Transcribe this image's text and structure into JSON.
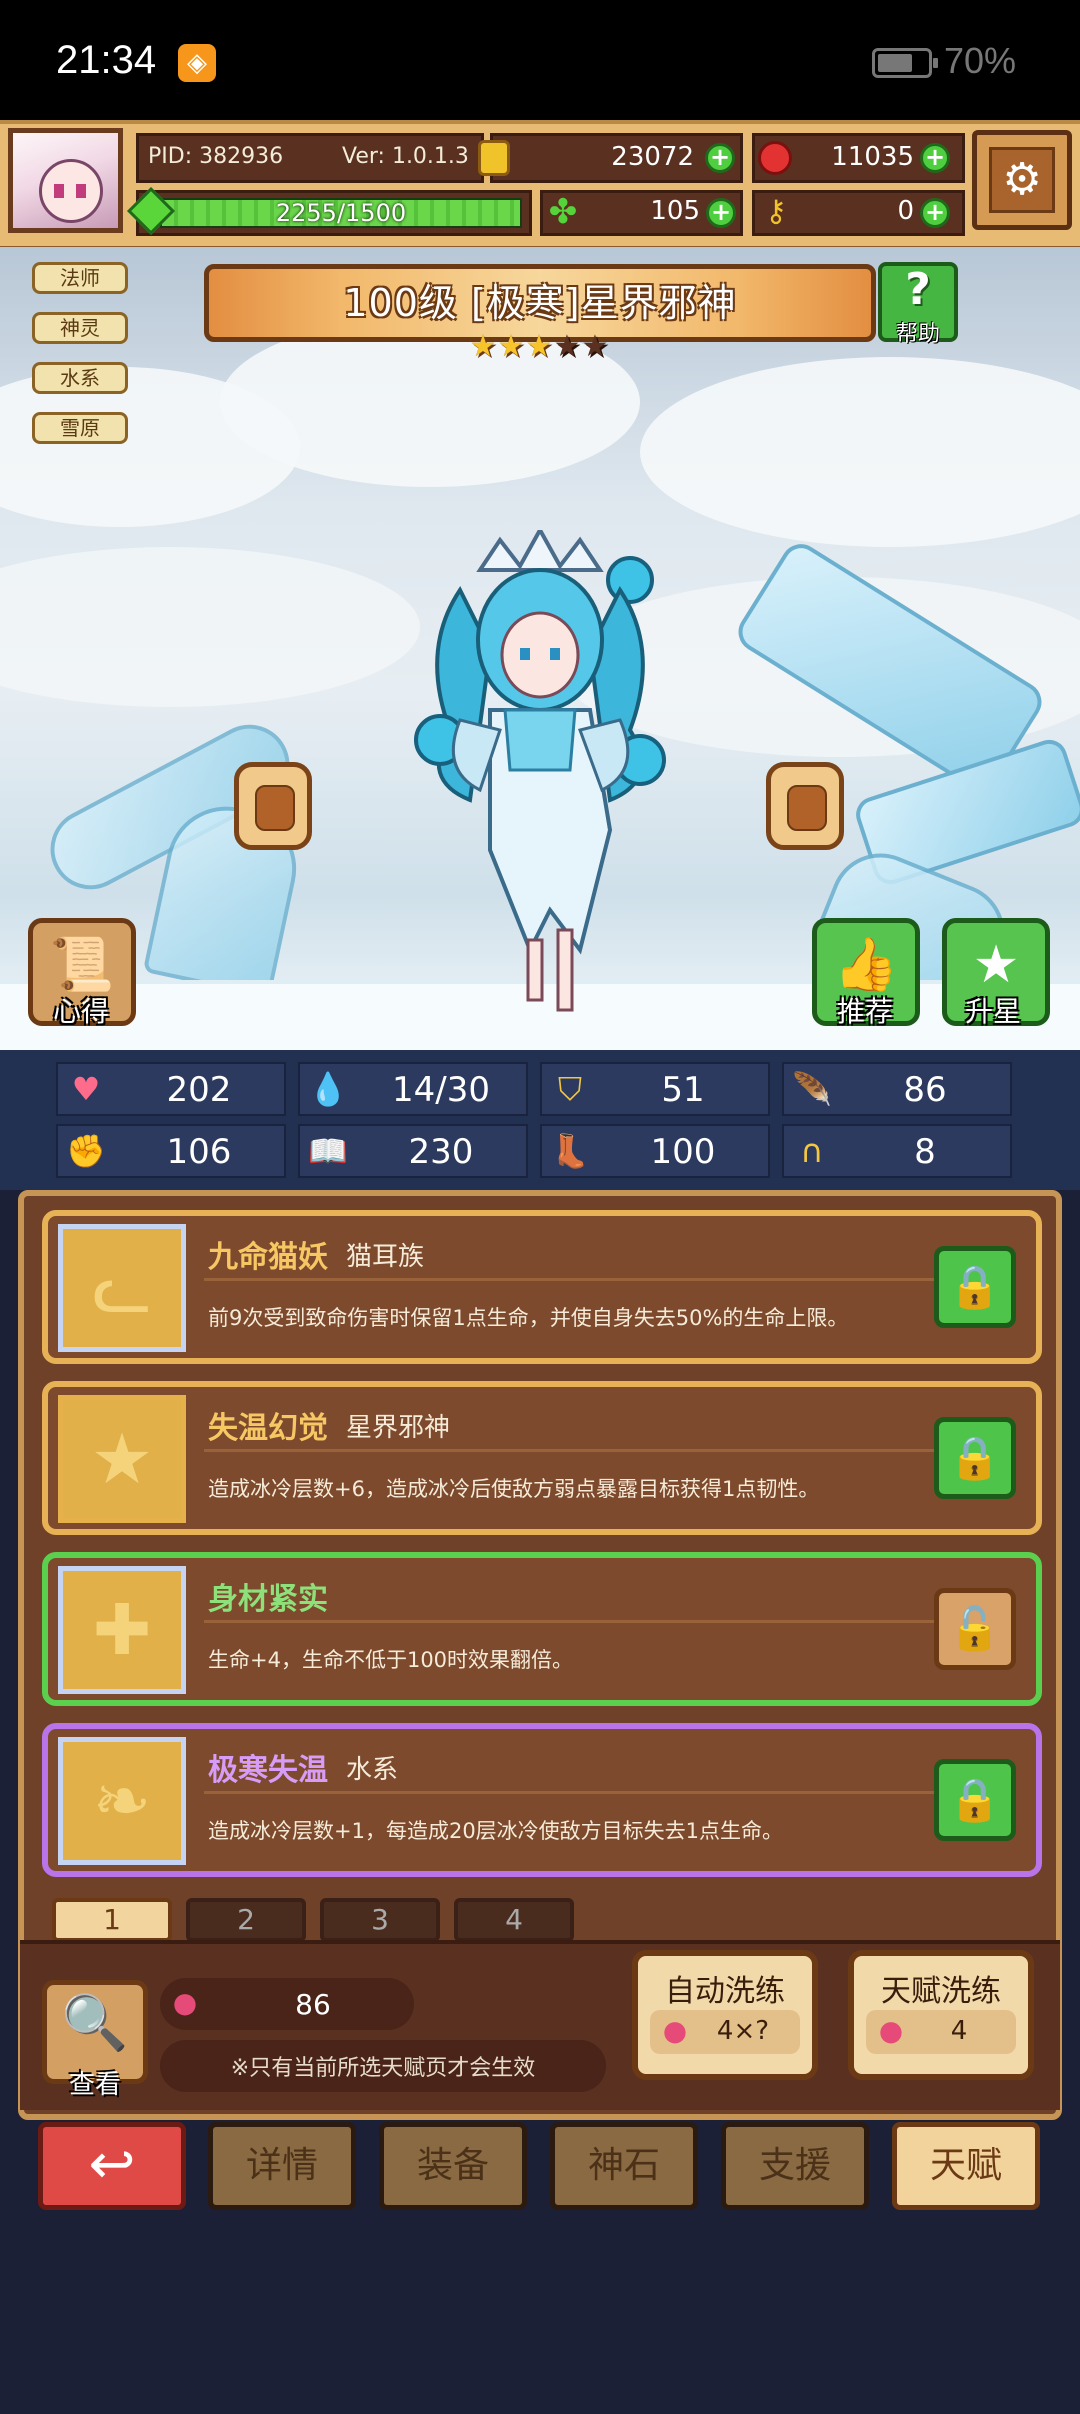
{
  "status_bar": {
    "time": "21:34",
    "battery_percent": "70%",
    "battery_level": 0.7
  },
  "header": {
    "pid": "PID: 382936",
    "version": "Ver: 1.0.1.3",
    "gold": "23072",
    "gems": "11035",
    "exp": "2255/1500",
    "clover": "105",
    "keys": "0"
  },
  "tags": [
    "法师",
    "神灵",
    "水系",
    "雪原"
  ],
  "hero": {
    "title": "100级 [极寒]星界邪神",
    "stars_filled": 3,
    "stars_total": 5,
    "help_label": "帮助"
  },
  "scene_buttons": {
    "xinde": "心得",
    "recommend": "推荐",
    "star_up": "升星"
  },
  "stats": [
    {
      "icon": "heart-icon",
      "value": "202"
    },
    {
      "icon": "water-drop-icon",
      "value": "14/30"
    },
    {
      "icon": "shield-icon",
      "value": "51"
    },
    {
      "icon": "wing-icon",
      "value": "86"
    },
    {
      "icon": "fist-icon",
      "value": "106"
    },
    {
      "icon": "book-icon",
      "value": "230"
    },
    {
      "icon": "boot-icon",
      "value": "100"
    },
    {
      "icon": "horseshoe-icon",
      "value": "8"
    }
  ],
  "talents": [
    {
      "name": "九命猫妖",
      "sub": "猫耳族",
      "desc": "前9次受到致命伤害时保留1点生命，并使自身失去50%的生命上限。",
      "style": "gold",
      "locked": true,
      "icon": "cat-icon"
    },
    {
      "name": "失温幻觉",
      "sub": "星界邪神",
      "desc": "造成冰冷层数+6，造成冰冷后使敌方弱点暴露目标获得1点韧性。",
      "style": "gold",
      "locked": true,
      "icon": "star-icon"
    },
    {
      "name": "身材紧实",
      "sub": "",
      "desc": "生命+4，生命不低于100时效果翻倍。",
      "style": "green",
      "locked": false,
      "icon": "cross-icon"
    },
    {
      "name": "极寒失温",
      "sub": "水系",
      "desc": "造成冰冷层数+1，每造成20层冰冷使敌方目标失去1点生命。",
      "style": "purple",
      "locked": true,
      "icon": "flame-icon"
    }
  ],
  "pages": [
    "1",
    "2",
    "3",
    "4"
  ],
  "bottom": {
    "view_label": "查看",
    "fruit_count": "86",
    "note": "※只有当前所选天赋页才会生效",
    "auto_refine_title": "自动洗练",
    "auto_refine_cost": "4×?",
    "talent_refine_title": "天赋洗练",
    "talent_refine_cost": "4"
  },
  "nav": [
    "详情",
    "装备",
    "神石",
    "支援",
    "天赋"
  ]
}
